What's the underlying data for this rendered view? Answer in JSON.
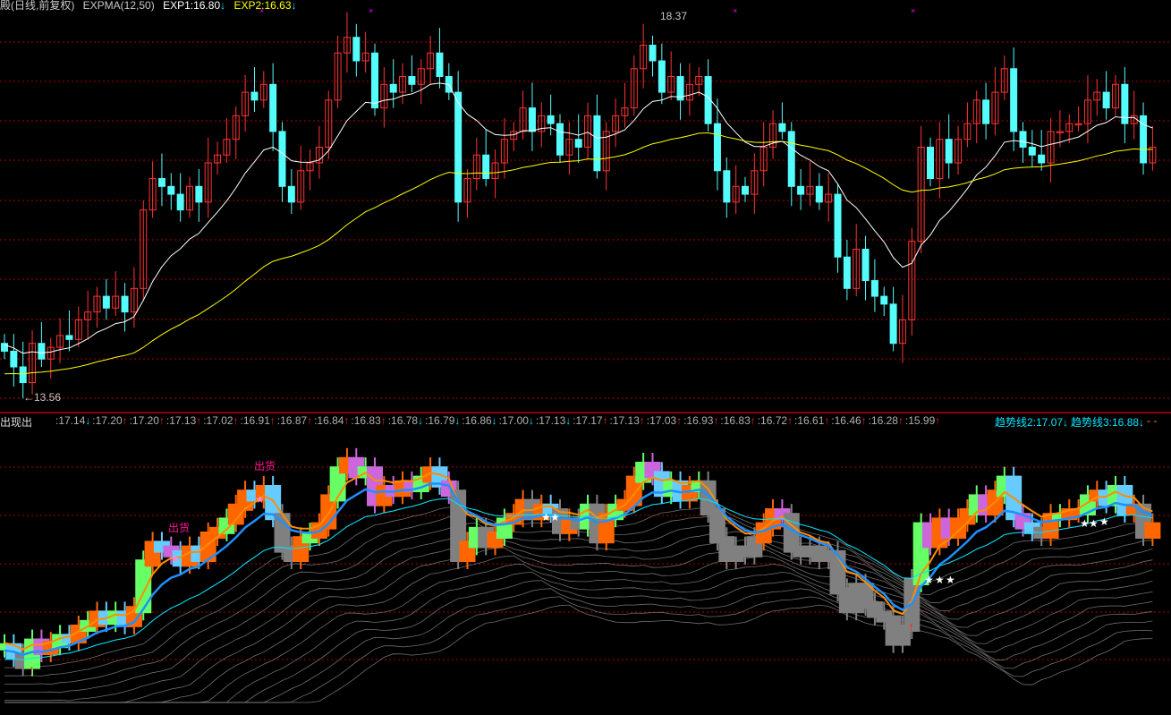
{
  "header": {
    "title": "殿(日线,前复权)",
    "indicator": "EXPMA(12,50)",
    "exp1": "EXP1:16.80",
    "exp1_arrow": "↓",
    "exp2": "EXP2:16.63",
    "exp2_arrow": "↓"
  },
  "annotations": {
    "high_label": "18.37",
    "low_label": "←13.56",
    "sell_label_1": "出货",
    "sell_label_2": "出货"
  },
  "lower_panel": {
    "title": "出现出",
    "values": [
      {
        "v": ":17.14",
        "a": "↓",
        "c": "#00e5ff"
      },
      {
        "v": ":17.20",
        "a": "↑",
        "c": "#ff2020"
      },
      {
        "v": ":17.20",
        "a": "↑",
        "c": "#ff2020"
      },
      {
        "v": ":17.13",
        "a": "↑",
        "c": "#ff2020"
      },
      {
        "v": ":17.02",
        "a": "↑",
        "c": "#ff2020"
      },
      {
        "v": ":16.91",
        "a": "↑",
        "c": "#ff2020"
      },
      {
        "v": ":16.87",
        "a": "↑",
        "c": "#ff2020"
      },
      {
        "v": ":16.84",
        "a": "↑",
        "c": "#ff2020"
      },
      {
        "v": ":16.83",
        "a": "↑",
        "c": "#ff2020"
      },
      {
        "v": ":16.78",
        "a": "↓",
        "c": "#00e5ff"
      },
      {
        "v": ":16.79",
        "a": "↓",
        "c": "#00e5ff"
      },
      {
        "v": ":16.86",
        "a": "↓",
        "c": "#00e5ff"
      },
      {
        "v": ":17.00",
        "a": "↓",
        "c": "#00e5ff"
      },
      {
        "v": ":17.13",
        "a": "↓",
        "c": "#00e5ff"
      },
      {
        "v": ":17.17",
        "a": "↑",
        "c": "#ff2020"
      },
      {
        "v": ":17.13",
        "a": "↑",
        "c": "#ff2020"
      },
      {
        "v": ":17.03",
        "a": "↑",
        "c": "#ff2020"
      },
      {
        "v": ":16.93",
        "a": "↑",
        "c": "#ff2020"
      },
      {
        "v": ":16.83",
        "a": "↑",
        "c": "#ff2020"
      },
      {
        "v": ":16.72",
        "a": "↑",
        "c": "#ff2020"
      },
      {
        "v": ":16.61",
        "a": "↑",
        "c": "#ff2020"
      },
      {
        "v": ":16.46",
        "a": "↑",
        "c": "#ff2020"
      },
      {
        "v": ":16.28",
        "a": "↑",
        "c": "#ff2020"
      },
      {
        "v": ":15.99",
        "a": "↑",
        "c": "#ff2020"
      }
    ],
    "trend2": "趋势线2:17.07",
    "trend2_arrow": "↓",
    "trend3": "趋势线3:16.88",
    "trend3_arrow": "↓",
    "tail": "- -"
  },
  "colors": {
    "up": "#ff3232",
    "down": "#54fcfc",
    "exp1": "#ffffff",
    "exp2": "#ffff00",
    "grid": "#b00000",
    "orange": "#ff6600",
    "green": "#66ff66",
    "lightblue": "#66ccff",
    "purple": "#cc66dd",
    "gray": "#808080"
  },
  "chart_data": {
    "type": "candlestick",
    "title": "日线,前复权 EXPMA(12,50)",
    "series_note": "close prices per bar; open = previous close",
    "closes": [
      14.1,
      13.9,
      13.7,
      14.2,
      14.0,
      14.15,
      14.3,
      14.25,
      14.5,
      14.6,
      14.8,
      14.65,
      14.8,
      14.6,
      14.9,
      15.9,
      16.3,
      16.2,
      16.1,
      15.9,
      16.2,
      16.0,
      16.5,
      16.6,
      16.8,
      17.1,
      17.4,
      17.3,
      17.5,
      16.9,
      16.2,
      16.0,
      16.4,
      16.5,
      16.7,
      17.3,
      17.9,
      18.1,
      17.8,
      17.9,
      17.2,
      17.5,
      17.4,
      17.6,
      17.5,
      17.7,
      17.9,
      17.6,
      17.4,
      16.0,
      16.3,
      16.6,
      16.3,
      16.5,
      16.8,
      16.9,
      17.2,
      16.9,
      17.1,
      17.0,
      16.6,
      16.8,
      16.7,
      17.1,
      16.4,
      16.9,
      17.1,
      17.2,
      17.7,
      18.0,
      17.8,
      17.4,
      17.6,
      17.3,
      17.5,
      17.6,
      17.0,
      16.4,
      16.0,
      16.2,
      16.1,
      16.4,
      16.7,
      17.0,
      16.9,
      16.2,
      16.1,
      16.2,
      16.0,
      16.1,
      15.3,
      14.9,
      15.4,
      15.0,
      14.8,
      14.7,
      14.2,
      14.5,
      15.5,
      16.7,
      16.3,
      16.8,
      16.5,
      16.8,
      17.0,
      17.3,
      17.0,
      17.4,
      17.7,
      16.9,
      16.7,
      16.6,
      16.5,
      16.9,
      16.9,
      17.0,
      17.0,
      17.3,
      17.4,
      17.2,
      17.5,
      17.0,
      17.1,
      16.5,
      16.7
    ],
    "price_high": 18.37,
    "price_low": 13.56,
    "ylim": [
      13.4,
      18.6
    ],
    "exp_periods": [
      12,
      50
    ],
    "grid": true
  }
}
